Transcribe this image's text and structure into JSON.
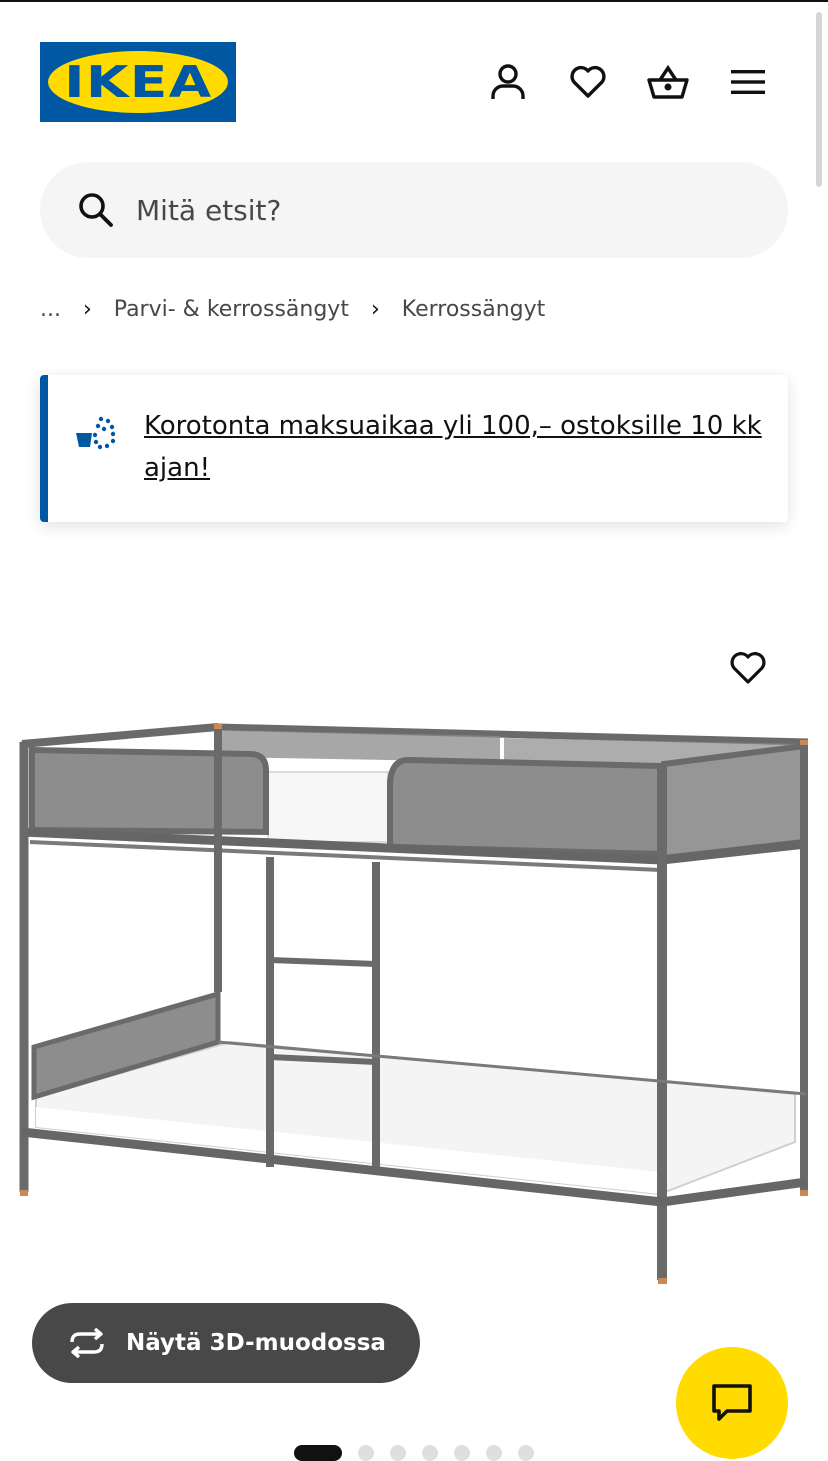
{
  "header": {
    "logo_text": "IKEA",
    "icons": [
      "profile-icon",
      "heart-icon",
      "shopping-basket-icon",
      "hamburger-menu-icon"
    ]
  },
  "search": {
    "placeholder": "Mitä etsit?"
  },
  "breadcrumb": {
    "ellipsis": "...",
    "items": [
      "Parvi- & kerrossängyt",
      "Kerrossängyt"
    ]
  },
  "promo": {
    "text": "Korotonta maksuaikaa yli 100,– ostoksille 10 kk ajan!",
    "icon": "payment-icon",
    "accent": "#0058a3"
  },
  "product": {
    "image": "bunk-bed-image",
    "favourite_icon": "heart-icon"
  },
  "view3d": {
    "label": "Näytä 3D-muodossa",
    "icon": "rotate-3d-icon"
  },
  "chat": {
    "icon": "chat-icon",
    "color": "#ffdb00"
  },
  "carousel": {
    "dot_count": 7,
    "active_index": 0
  },
  "colors": {
    "brand_blue": "#0058a3",
    "brand_yellow": "#ffdb00",
    "dark_button": "#484848"
  }
}
